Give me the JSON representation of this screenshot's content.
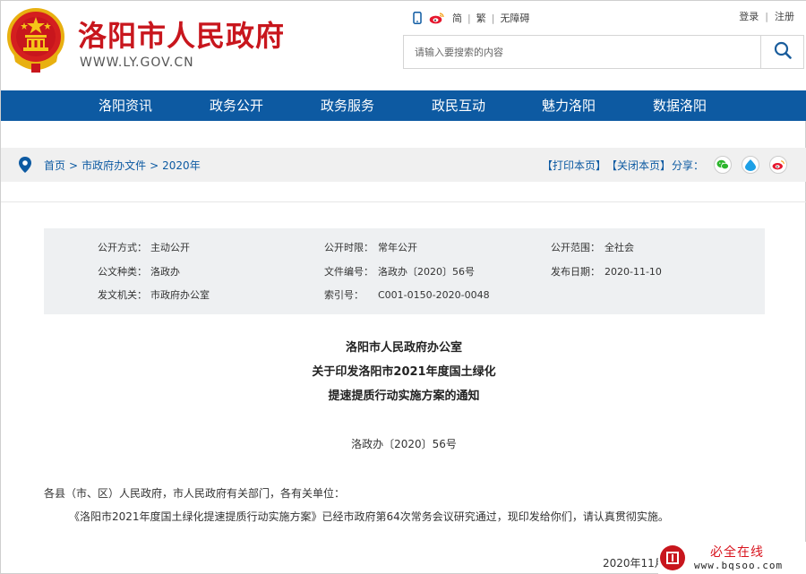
{
  "header": {
    "site_name": "洛阳市人民政府",
    "site_url": "WWW.LY.GOV.CN",
    "top_links": {
      "simplified": "简",
      "traditional": "繁",
      "accessible": "无障碍"
    },
    "account": {
      "login": "登录",
      "register": "注册"
    },
    "search": {
      "placeholder": "请输入要搜索的内容"
    },
    "icons": [
      "mobile-icon",
      "weibo-icon",
      "search-icon",
      "national-emblem-icon"
    ]
  },
  "nav": {
    "items": [
      "洛阳资讯",
      "政务公开",
      "政务服务",
      "政民互动",
      "魅力洛阳",
      "数据洛阳"
    ]
  },
  "breadcrumb": {
    "items": [
      "首页",
      "市政府办文件",
      "2020年"
    ],
    "separator": ">",
    "print": "【打印本页】",
    "close": "【关闭本页】",
    "share_label": "分享：",
    "share_icons": [
      "wechat-icon",
      "qzone-icon",
      "weibo-icon"
    ]
  },
  "meta": {
    "open_method_label": "公开方式：",
    "open_method": "主动公开",
    "open_time_label": "公开时限：",
    "open_time": "常年公开",
    "open_scope_label": "公开范围：",
    "open_scope": "全社会",
    "doc_type_label": "公文种类：",
    "doc_type": "洛政办",
    "doc_no_label": "文件编号：",
    "doc_no": "洛政办〔2020〕56号",
    "publish_date_label": "发布日期：",
    "publish_date": "2020-11-10",
    "issuer_label": "发文机关：",
    "issuer": "市政府办公室",
    "index_label": "索引号：",
    "index": "C001-0150-2020-0048"
  },
  "document": {
    "title_line1": "洛阳市人民政府办公室",
    "title_line2": "关于印发洛阳市2021年度国土绿化",
    "title_line3": "提速提质行动实施方案的通知",
    "doc_number": "洛政办〔2020〕56号",
    "salutation": "各县（市、区）人民政府，市人民政府有关部门，各有关单位：",
    "body": "《洛阳市2021年度国土绿化提速提质行动实施方案》已经市政府第64次常务会议研究通过，现印发给你们，请认真贯彻实施。",
    "date_partial": "2020年11月6日"
  },
  "watermark": {
    "brand": "必全在线",
    "url": "www.bqsoo.com"
  },
  "colors": {
    "brand_red": "#c8161d",
    "nav_blue": "#0d5aa2",
    "meta_bg": "#eef0f2",
    "crumb_bg": "#f0f0f0"
  }
}
